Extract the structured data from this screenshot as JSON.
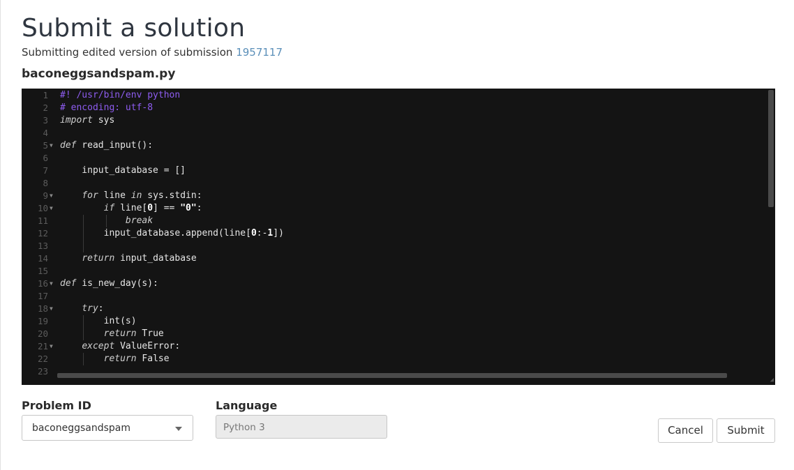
{
  "page": {
    "title": "Submit a solution",
    "subtitle_prefix": "Submitting edited version of submission",
    "submission_id": "1957117",
    "filename": "baconeggsandspam.py"
  },
  "editor": {
    "language_mode": "python",
    "lines": [
      "#! /usr/bin/env python",
      "# encoding: utf-8",
      "import sys",
      "",
      "def read_input():",
      "",
      "    input_database = []",
      "",
      "    for line in sys.stdin:",
      "        if line[0] == \"0\":",
      "            break",
      "        input_database.append(line[0:-1])",
      "",
      "    return input_database",
      "",
      "def is_new_day(s):",
      "",
      "    try:",
      "        int(s)",
      "        return True",
      "    except ValueError:",
      "        return False",
      ""
    ],
    "foldable_lines": [
      5,
      9,
      10,
      16,
      18,
      21
    ]
  },
  "form": {
    "problem_id_label": "Problem ID",
    "problem_id_value": "baconeggsandspam",
    "language_label": "Language",
    "language_value": "Python 3",
    "cancel_label": "Cancel",
    "submit_label": "Submit"
  },
  "colors": {
    "editor_bg": "#141414",
    "comment": "#8e5cf0",
    "link": "#5b8fb9"
  },
  "icons": [
    "fold-arrow-icon",
    "dropdown-caret-icon",
    "resize-handle-icon"
  ]
}
